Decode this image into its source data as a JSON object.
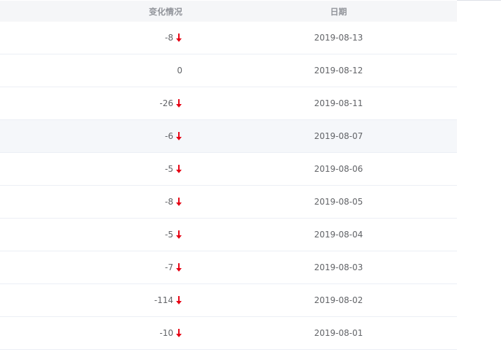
{
  "table": {
    "headers": {
      "change": "变化情况",
      "date": "日期"
    },
    "rows": [
      {
        "change": "-8",
        "direction": "down",
        "date": "2019-08-13"
      },
      {
        "change": "0",
        "direction": "none",
        "date": "2019-08-12"
      },
      {
        "change": "-26",
        "direction": "down",
        "date": "2019-08-11"
      },
      {
        "change": "-6",
        "direction": "down",
        "date": "2019-08-07"
      },
      {
        "change": "-5",
        "direction": "down",
        "date": "2019-08-06"
      },
      {
        "change": "-8",
        "direction": "down",
        "date": "2019-08-05"
      },
      {
        "change": "-5",
        "direction": "down",
        "date": "2019-08-04"
      },
      {
        "change": "-7",
        "direction": "down",
        "date": "2019-08-03"
      },
      {
        "change": "-114",
        "direction": "down",
        "date": "2019-08-02"
      },
      {
        "change": "-10",
        "direction": "down",
        "date": "2019-08-01"
      }
    ]
  },
  "colors": {
    "down_arrow": "#e60012",
    "header_bg": "#f5f6f8",
    "hover_row_bg": "#f5f7fa",
    "divider": "#ebeef5"
  },
  "icons": {
    "down": "arrow-down-icon"
  }
}
